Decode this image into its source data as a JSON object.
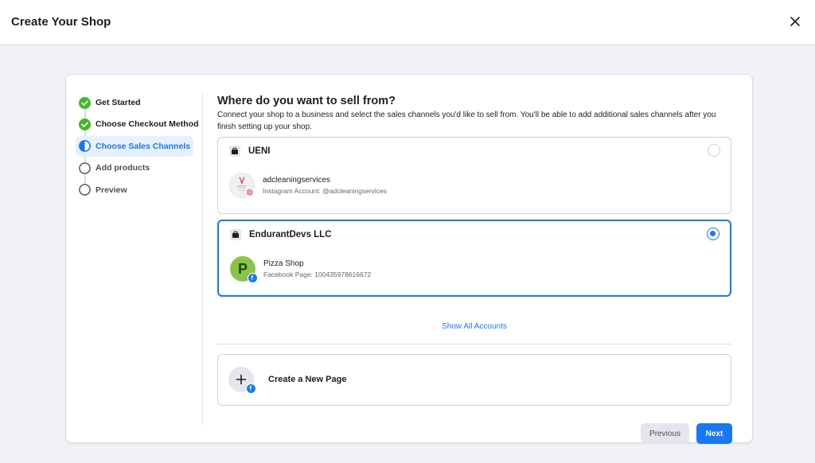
{
  "header": {
    "title": "Create Your Shop",
    "close_label": "close"
  },
  "steps": [
    {
      "label": "Get Started",
      "state": "done"
    },
    {
      "label": "Choose Checkout Method",
      "state": "done"
    },
    {
      "label": "Choose Sales Channels",
      "state": "active"
    },
    {
      "label": "Add products",
      "state": "pending"
    },
    {
      "label": "Preview",
      "state": "pending"
    }
  ],
  "main": {
    "heading": "Where do you want to sell from?",
    "description": "Connect your shop to a business and select the sales channels you'd like to sell from. You'll be able to add additional sales channels after you finish setting up your shop."
  },
  "accounts": [
    {
      "business": "UENI",
      "selected": false,
      "channel_name": "adcleaningservices",
      "channel_detail": "Instagram Account: @adcleaningservices",
      "channel_type": "instagram"
    },
    {
      "business": "EndurantDevs LLC",
      "selected": true,
      "channel_name": "Pizza Shop",
      "channel_detail": "Facebook Page: 100435978616672",
      "channel_type": "facebook",
      "avatar_letter": "P"
    }
  ],
  "show_all": "Show All Accounts",
  "create_page": "Create a New Page",
  "buttons": {
    "previous": "Previous",
    "next": "Next"
  },
  "colors": {
    "accent": "#1877f2",
    "success": "#42b72a"
  }
}
